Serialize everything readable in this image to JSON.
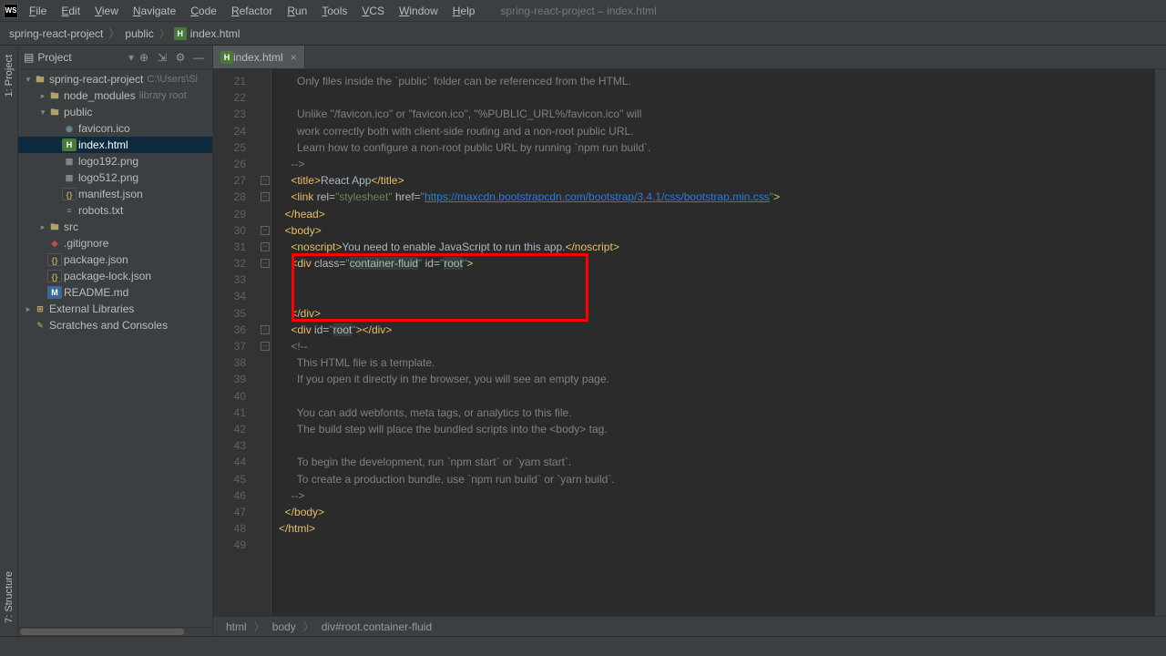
{
  "app": {
    "logo": "WS"
  },
  "menu": [
    "File",
    "Edit",
    "View",
    "Navigate",
    "Code",
    "Refactor",
    "Run",
    "Tools",
    "VCS",
    "Window",
    "Help"
  ],
  "window_title": "spring-react-project – index.html",
  "breadcrumbs": [
    "spring-react-project",
    "public",
    "index.html"
  ],
  "projectPanel": {
    "title": "Project"
  },
  "leftTabs": {
    "project": "1: Project",
    "structure": "7: Structure"
  },
  "tree": [
    {
      "indent": 0,
      "chev": "▾",
      "icon": "folder",
      "label": "spring-react-project",
      "hint": "C:\\Users\\Si"
    },
    {
      "indent": 1,
      "chev": "▸",
      "icon": "folder",
      "label": "node_modules",
      "hint": "library root"
    },
    {
      "indent": 1,
      "chev": "▾",
      "icon": "folder",
      "label": "public"
    },
    {
      "indent": 2,
      "chev": "",
      "icon": "ico",
      "label": "favicon.ico"
    },
    {
      "indent": 2,
      "chev": "",
      "icon": "html",
      "label": "index.html",
      "selected": true
    },
    {
      "indent": 2,
      "chev": "",
      "icon": "img",
      "label": "logo192.png"
    },
    {
      "indent": 2,
      "chev": "",
      "icon": "img",
      "label": "logo512.png"
    },
    {
      "indent": 2,
      "chev": "",
      "icon": "json",
      "label": "manifest.json"
    },
    {
      "indent": 2,
      "chev": "",
      "icon": "txt",
      "label": "robots.txt"
    },
    {
      "indent": 1,
      "chev": "▸",
      "icon": "folder",
      "label": "src"
    },
    {
      "indent": 1,
      "chev": "",
      "icon": "git",
      "label": ".gitignore"
    },
    {
      "indent": 1,
      "chev": "",
      "icon": "json",
      "label": "package.json"
    },
    {
      "indent": 1,
      "chev": "",
      "icon": "json",
      "label": "package-lock.json"
    },
    {
      "indent": 1,
      "chev": "",
      "icon": "md",
      "label": "README.md"
    },
    {
      "indent": 0,
      "chev": "▸",
      "icon": "lib",
      "label": "External Libraries"
    },
    {
      "indent": 0,
      "chev": "",
      "icon": "scratch",
      "label": "Scratches and Consoles"
    }
  ],
  "tab": {
    "label": "index.html",
    "close": "×"
  },
  "code": {
    "startLine": 21,
    "lines": [
      {
        "t": "comment",
        "txt": "      Only files inside the `public` folder can be referenced from the HTML."
      },
      {
        "t": "blank",
        "txt": ""
      },
      {
        "t": "comment",
        "txt": "      Unlike \"/favicon.ico\" or \"favicon.ico\", \"%PUBLIC_URL%/favicon.ico\" will"
      },
      {
        "t": "comment",
        "txt": "      work correctly both with client-side routing and a non-root public URL."
      },
      {
        "t": "comment",
        "txt": "      Learn how to configure a non-root public URL by running `npm run build`."
      },
      {
        "t": "comment",
        "txt": "    -->"
      },
      {
        "t": "title",
        "txt": ""
      },
      {
        "t": "link",
        "txt": ""
      },
      {
        "t": "headclose",
        "txt": ""
      },
      {
        "t": "bodyopen",
        "txt": ""
      },
      {
        "t": "noscript",
        "txt": ""
      },
      {
        "t": "divroot",
        "txt": ""
      },
      {
        "t": "blank",
        "txt": ""
      },
      {
        "t": "blank",
        "txt": ""
      },
      {
        "t": "divclose",
        "txt": ""
      },
      {
        "t": "divroot2",
        "txt": ""
      },
      {
        "t": "comment",
        "txt": "    <!--"
      },
      {
        "t": "comment",
        "txt": "      This HTML file is a template."
      },
      {
        "t": "comment",
        "txt": "      If you open it directly in the browser, you will see an empty page."
      },
      {
        "t": "blank",
        "txt": ""
      },
      {
        "t": "comment",
        "txt": "      You can add webfonts, meta tags, or analytics to this file."
      },
      {
        "t": "comment",
        "txt": "      The build step will place the bundled scripts into the <body> tag."
      },
      {
        "t": "blank",
        "txt": ""
      },
      {
        "t": "comment",
        "txt": "      To begin the development, run `npm start` or `yarn start`."
      },
      {
        "t": "comment",
        "txt": "      To create a production bundle, use `npm run build` or `yarn build`."
      },
      {
        "t": "comment",
        "txt": "    -->"
      },
      {
        "t": "bodyclose",
        "txt": ""
      },
      {
        "t": "htmlclose",
        "txt": ""
      },
      {
        "t": "blank",
        "txt": ""
      }
    ],
    "title_text": "React App",
    "link_href": "https://maxcdn.bootstrapcdn.com/bootstrap/3.4.1/css/bootstrap.min.css",
    "noscript_text": "You need to enable JavaScript to run this app.",
    "div_class": "container-fluid",
    "div_id": "root",
    "div2_id": "root"
  },
  "editorCrumbs": [
    "html",
    "body",
    "div#root.container-fluid"
  ],
  "highlight": {
    "startLine": 32,
    "endLine": 35
  }
}
